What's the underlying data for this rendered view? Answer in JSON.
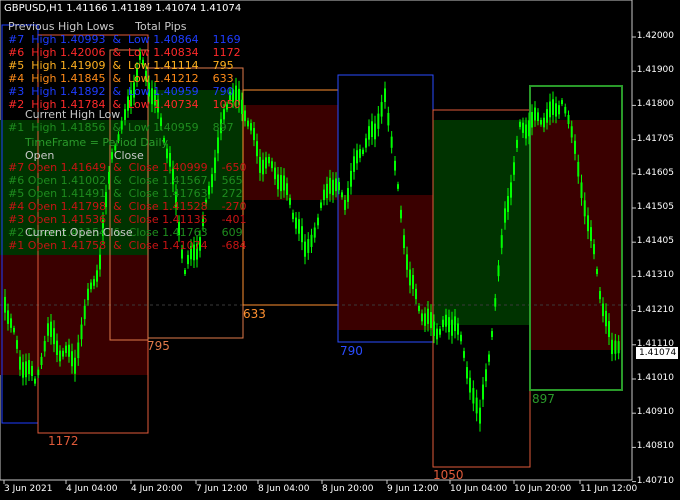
{
  "window": {
    "symbol_title": "GBPUSD,H1  1.41166 1.41189 1.41074 1.41074"
  },
  "price_axis": {
    "labels": [
      "1.42000",
      "1.41900",
      "1.41800",
      "1.41705",
      "1.41605",
      "1.41505",
      "1.41405",
      "1.41310",
      "1.41210",
      "1.41110",
      "1.41010",
      "1.40910",
      "1.40810",
      "1.40710"
    ],
    "current_price": "1.41074"
  },
  "time_axis": {
    "labels": [
      "3 Jun 2021",
      "4 Jun 04:00",
      "4 Jun 20:00",
      "7 Jun 12:00",
      "8 Jun 04:00",
      "8 Jun 20:00",
      "9 Jun 12:00",
      "10 Jun 04:00",
      "10 Jun 20:00",
      "11 Jun 12:00"
    ]
  },
  "panel": {
    "header": "Previous High Lows      Total Pips",
    "hl_rows": [
      {
        "text": "#7  High 1.40993  &  Low 1.40864    1169",
        "color": "#1e3cff"
      },
      {
        "text": "#6  High 1.42006  &  Low 1.40834    1172",
        "color": "#ff2a2a"
      },
      {
        "text": "#5  High 1.41909  &  Low 1.41114    795",
        "color": "#ffb020"
      },
      {
        "text": "#4  High 1.41845  &  Low 1.41212    633",
        "color": "#ff8c1a"
      },
      {
        "text": "#3  High 1.41892  &  Low 1.40959    790",
        "color": "#1e3cff"
      },
      {
        "text": "#2  High 1.41784  &  Low 1.40734    1050",
        "color": "#ff2a2a"
      }
    ],
    "current_hl_label": "Current High Low",
    "current_hl_row": "#1  High 1.41856  &  Low 1.40959    897",
    "timeframe_label": "TimeFrame = Period Daily",
    "oc_header": "Open                 Close",
    "oc_rows": [
      {
        "text": "#7 Open 1.41649  &  Close 1.40999    -650",
        "color": "#c81414"
      },
      {
        "text": "#6 Open 1.41002  &  Close 1.41567    565",
        "color": "#1e8c1e"
      },
      {
        "text": "#5 Open 1.41491  &  Close 1.41763    272",
        "color": "#1e8c1e"
      },
      {
        "text": "#4 Open 1.41798  &  Close 1.41528    -270",
        "color": "#c81414"
      },
      {
        "text": "#3 Open 1.41536  &  Close 1.41135    -401",
        "color": "#c81414"
      },
      {
        "text": "#2 Open 1.41154  &  Close 1.41763    609",
        "color": "#1e8c1e"
      }
    ],
    "current_oc_label": "Current Open Close",
    "current_oc_row": "#1 Open 1.41758  &  Close 1.41074    -684"
  },
  "box_labels": [
    {
      "text": "1172",
      "color": "#e05a3a"
    },
    {
      "text": "795",
      "color": "#e07a4a"
    },
    {
      "text": "633",
      "color": "#ff9030"
    },
    {
      "text": "790",
      "color": "#2a4cff"
    },
    {
      "text": "1050",
      "color": "#e05a3a"
    },
    {
      "text": "897",
      "color": "#2a9a2a"
    }
  ],
  "colors": {
    "candle": "#00ff00",
    "grid": "#3a3a3a",
    "up_zone": "#004000",
    "down_zone": "#400000"
  }
}
